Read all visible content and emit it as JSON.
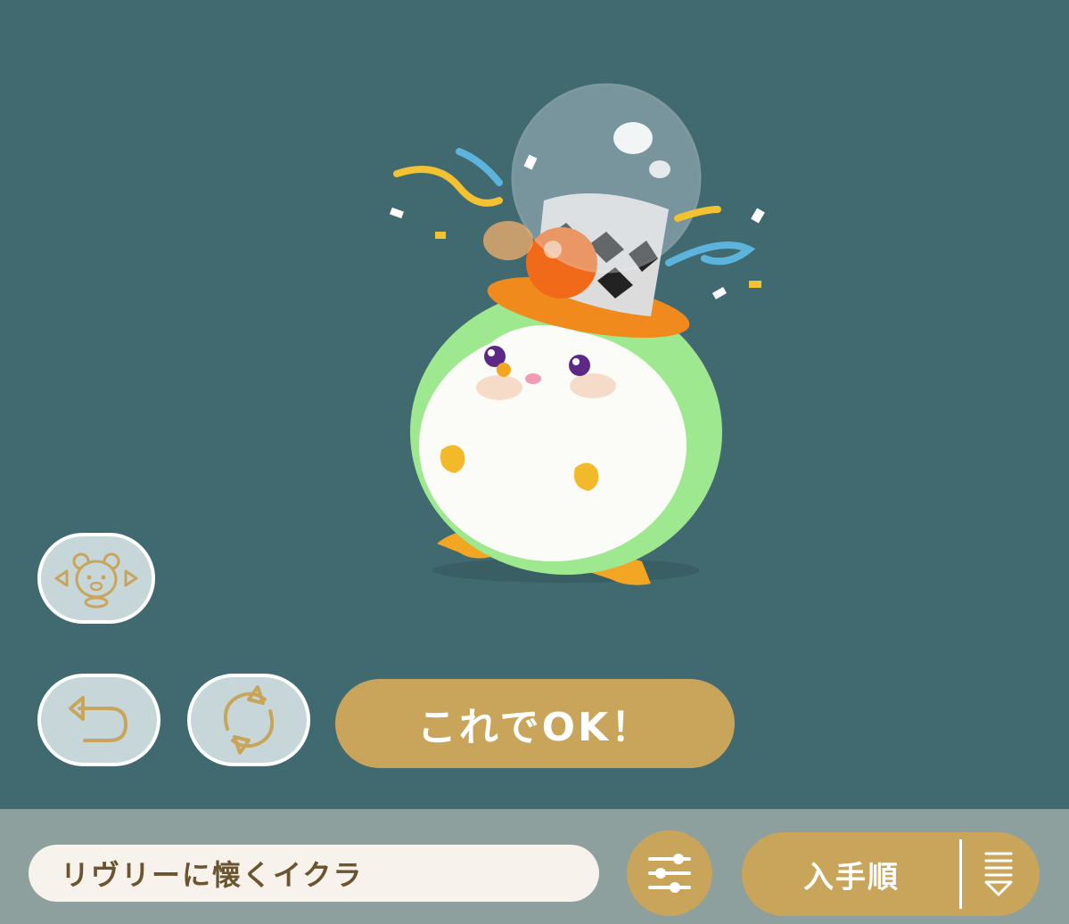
{
  "stage": {
    "background": "#416970",
    "character_image": "penguin-with-bubble-top-hat"
  },
  "controls": {
    "move_icon": "bear-face-arrows-icon",
    "undo_icon": "undo-arrow-icon",
    "rotate_icon": "rotate-arrows-icon",
    "confirm_label": "これでOK！"
  },
  "bottom_bar": {
    "item_name": "リヴリーに懐くイクラ",
    "filter_icon": "sliders-icon",
    "sort_label": "入手順",
    "sort_icon": "sort-order-icon"
  },
  "colors": {
    "accent": "#c9a55c",
    "button_bg": "#c7d7d9",
    "bar_bg": "#8da09d"
  }
}
